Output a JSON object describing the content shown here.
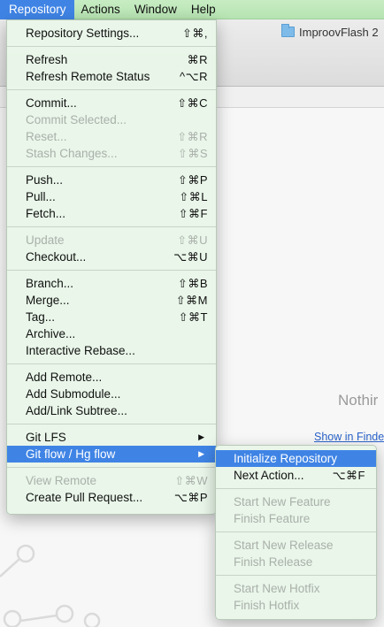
{
  "menubar": {
    "items": [
      "Repository",
      "Actions",
      "Window",
      "Help"
    ]
  },
  "window": {
    "repo_name": "ImproovFlash 2",
    "nothing_text": "Nothir",
    "show_in_finder": "Show in Finde"
  },
  "repository_menu": {
    "repository_settings": {
      "label": "Repository Settings...",
      "shortcut": "⇧⌘,"
    },
    "refresh": {
      "label": "Refresh",
      "shortcut": "⌘R"
    },
    "refresh_remote": {
      "label": "Refresh Remote Status",
      "shortcut": "^⌥R"
    },
    "commit": {
      "label": "Commit...",
      "shortcut": "⇧⌘C"
    },
    "commit_selected": {
      "label": "Commit Selected...",
      "shortcut": ""
    },
    "reset": {
      "label": "Reset...",
      "shortcut": "⇧⌘R"
    },
    "stash": {
      "label": "Stash Changes...",
      "shortcut": "⇧⌘S"
    },
    "push": {
      "label": "Push...",
      "shortcut": "⇧⌘P"
    },
    "pull": {
      "label": "Pull...",
      "shortcut": "⇧⌘L"
    },
    "fetch": {
      "label": "Fetch...",
      "shortcut": "⇧⌘F"
    },
    "update": {
      "label": "Update",
      "shortcut": "⇧⌘U"
    },
    "checkout": {
      "label": "Checkout...",
      "shortcut": "⌥⌘U"
    },
    "branch": {
      "label": "Branch...",
      "shortcut": "⇧⌘B"
    },
    "merge": {
      "label": "Merge...",
      "shortcut": "⇧⌘M"
    },
    "tag": {
      "label": "Tag...",
      "shortcut": "⇧⌘T"
    },
    "archive": {
      "label": "Archive...",
      "shortcut": ""
    },
    "interactive_rebase": {
      "label": "Interactive Rebase...",
      "shortcut": ""
    },
    "add_remote": {
      "label": "Add Remote...",
      "shortcut": ""
    },
    "add_submodule": {
      "label": "Add Submodule...",
      "shortcut": ""
    },
    "add_subtree": {
      "label": "Add/Link Subtree...",
      "shortcut": ""
    },
    "git_lfs": {
      "label": "Git LFS",
      "arrow": "▶"
    },
    "git_flow": {
      "label": "Git flow / Hg flow",
      "arrow": "▶"
    },
    "view_remote": {
      "label": "View Remote",
      "shortcut": "⇧⌘W"
    },
    "create_pull_request": {
      "label": "Create Pull Request...",
      "shortcut": "⌥⌘P"
    }
  },
  "gitflow_submenu": {
    "initialize": {
      "label": "Initialize Repository"
    },
    "next_action": {
      "label": "Next Action...",
      "shortcut": "⌥⌘F"
    },
    "start_feature": {
      "label": "Start New Feature"
    },
    "finish_feature": {
      "label": "Finish Feature"
    },
    "start_release": {
      "label": "Start New Release"
    },
    "finish_release": {
      "label": "Finish Release"
    },
    "start_hotfix": {
      "label": "Start New Hotfix"
    },
    "finish_hotfix": {
      "label": "Finish Hotfix"
    }
  },
  "icons": {
    "repo_folder": "folder-icon",
    "submenu_arrow": "chevron-right-icon"
  },
  "colors": {
    "menubar_bg": "#c7ecc3",
    "highlight": "#3f84e5",
    "link": "#2a62c9"
  }
}
